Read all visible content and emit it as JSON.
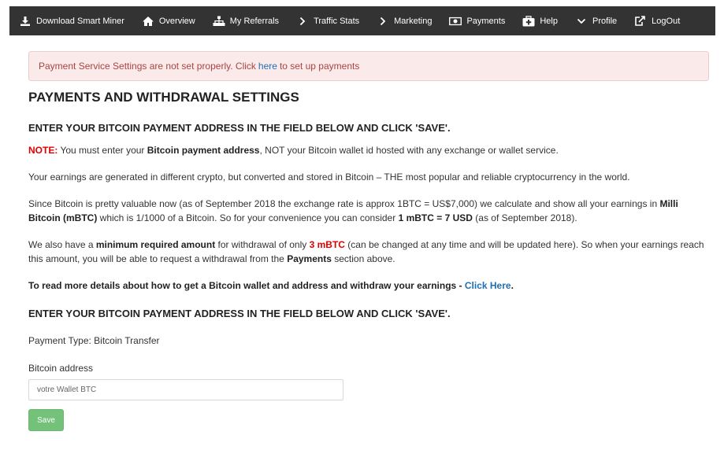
{
  "navbar": {
    "items": [
      {
        "label": "Download Smart Miner",
        "icon": "download-icon"
      },
      {
        "label": "Overview",
        "icon": "home-icon"
      },
      {
        "label": "My Referrals",
        "icon": "sitemap-icon"
      },
      {
        "label": "Traffic Stats",
        "icon": "chevron-right-icon"
      },
      {
        "label": "Marketing",
        "icon": "chevron-right-icon"
      },
      {
        "label": "Payments",
        "icon": "money-icon"
      },
      {
        "label": "Help",
        "icon": "medkit-icon"
      },
      {
        "label": "Profile",
        "icon": "chevron-down-icon"
      },
      {
        "label": "LogOut",
        "icon": "logout-icon"
      }
    ]
  },
  "alert": {
    "text_before": "Payment Service Settings are not set properly. Click",
    "link": "here",
    "text_after": "to set up payments"
  },
  "page_title": "PAYMENTS AND WITHDRAWAL SETTINGS",
  "section_heading_1": "ENTER YOUR BITCOIN PAYMENT ADDRESS IN THE FIELD BELOW AND CLICK 'SAVE'.",
  "note": {
    "label": "NOTE:",
    "t1": "You must enter your",
    "b1": "Bitcoin payment address",
    "t2": ", NOT your Bitcoin wallet id hosted with any exchange or wallet service."
  },
  "para_earnings": "Your earnings are generated in different crypto, but converted and stored in Bitcoin – THE most popular and reliable cryptocurrency in the world.",
  "para_mbtc": {
    "t1": "Since Bitcoin is pretty valuable now (as of September 2018 the exchange rate is approx 1BTC = US$7,000) we calculate and show all your earnings in",
    "b1": "Milli Bitcoin (mBTC)",
    "t2": "which is 1/1000 of a Bitcoin. So for your convenience you can consider",
    "b2": "1 mBTC = 7 USD",
    "t3": "(as of September 2018)."
  },
  "para_min": {
    "t1": "We also have a",
    "b1": "minimum required amount",
    "t2": "for withdrawal of only",
    "red": "3 mBTC",
    "t3": "(can be changed at any time and will be updated here). So when your earnings reach this amount, you will be able to request a withdrawal from the",
    "b2": "Payments",
    "t4": "section above."
  },
  "para_more": {
    "text": "To read more details about how to get a Bitcoin wallet and address and withdraw your earnings -",
    "link": "Click Here",
    "end": "."
  },
  "section_heading_2": "ENTER YOUR BITCOIN PAYMENT ADDRESS IN THE FIELD BELOW AND CLICK 'SAVE'.",
  "payment_type": "Payment Type: Bitcoin Transfer",
  "bitcoin_address_label": "Bitcoin address",
  "bitcoin_address_placeholder": "votre Wallet BTC",
  "save_label": "Save",
  "colors": {
    "navbar_bg": "#333333",
    "alert_bg": "#fbeaea",
    "alert_text": "#a94442",
    "link": "#1f6fb5",
    "note_red": "#e00000",
    "save_bg": "#74c27a"
  }
}
